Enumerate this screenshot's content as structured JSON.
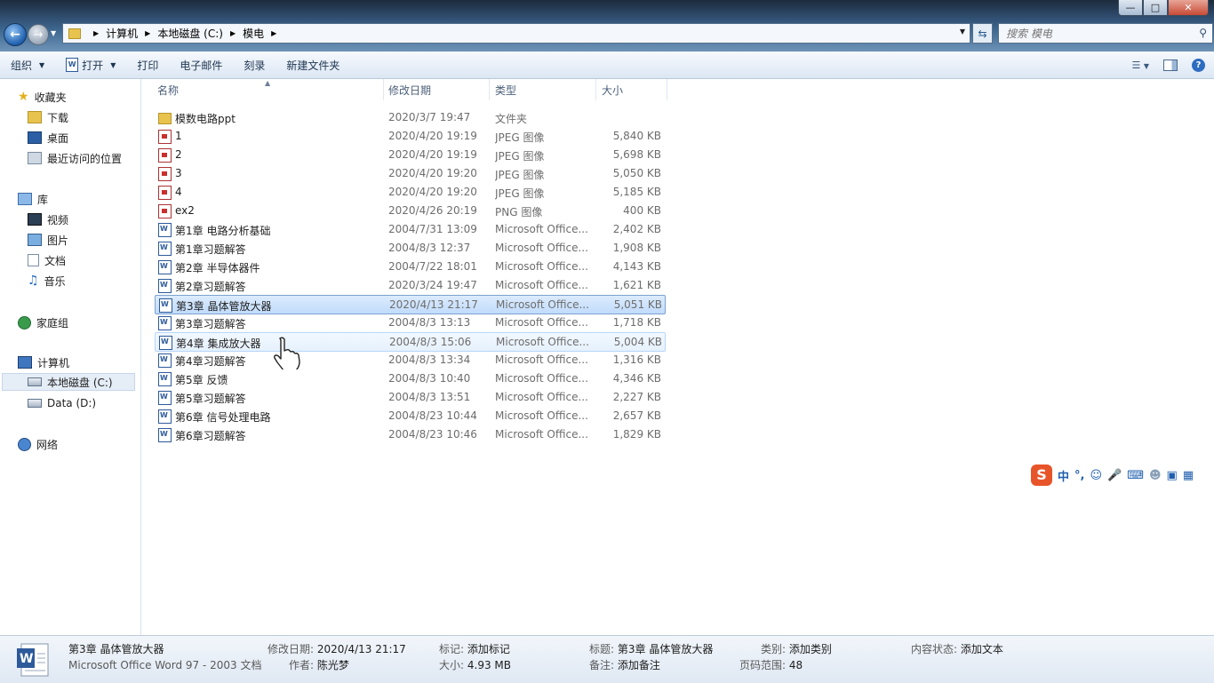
{
  "address": {
    "crumbs": [
      "计算机",
      "本地磁盘 (C:)",
      "模电"
    ],
    "search_placeholder": "搜索 模电"
  },
  "toolbar": {
    "organize": "组织",
    "open": "打开",
    "print": "打印",
    "email": "电子邮件",
    "burn": "刻录",
    "new_folder": "新建文件夹"
  },
  "nav": {
    "favorites": "收藏夹",
    "downloads": "下载",
    "desktop": "桌面",
    "recent": "最近访问的位置",
    "libraries": "库",
    "videos": "视频",
    "pictures": "图片",
    "documents": "文档",
    "music": "音乐",
    "homegroup": "家庭组",
    "computer": "计算机",
    "drive_c": "本地磁盘 (C:)",
    "drive_d": "Data (D:)",
    "network": "网络"
  },
  "columns": {
    "name": "名称",
    "date": "修改日期",
    "type": "类型",
    "size": "大小"
  },
  "files": [
    {
      "name": "模数电路ppt",
      "date": "2020/3/7 19:47",
      "type": "文件夹",
      "size": "",
      "icon": "folder"
    },
    {
      "name": "1",
      "date": "2020/4/20 19:19",
      "type": "JPEG 图像",
      "size": "5,840 KB",
      "icon": "image"
    },
    {
      "name": "2",
      "date": "2020/4/20 19:19",
      "type": "JPEG 图像",
      "size": "5,698 KB",
      "icon": "image"
    },
    {
      "name": "3",
      "date": "2020/4/20 19:20",
      "type": "JPEG 图像",
      "size": "5,050 KB",
      "icon": "image"
    },
    {
      "name": "4",
      "date": "2020/4/20 19:20",
      "type": "JPEG 图像",
      "size": "5,185 KB",
      "icon": "image"
    },
    {
      "name": "ex2",
      "date": "2020/4/26 20:19",
      "type": "PNG 图像",
      "size": "400 KB",
      "icon": "image"
    },
    {
      "name": "第1章 电路分析基础",
      "date": "2004/7/31 13:09",
      "type": "Microsoft Office...",
      "size": "2,402 KB",
      "icon": "word"
    },
    {
      "name": "第1章习题解答",
      "date": "2004/8/3 12:37",
      "type": "Microsoft Office...",
      "size": "1,908 KB",
      "icon": "word"
    },
    {
      "name": "第2章 半导体器件",
      "date": "2004/7/22 18:01",
      "type": "Microsoft Office...",
      "size": "4,143 KB",
      "icon": "word"
    },
    {
      "name": "第2章习题解答",
      "date": "2020/3/24 19:47",
      "type": "Microsoft Office...",
      "size": "1,621 KB",
      "icon": "word"
    },
    {
      "name": "第3章 晶体管放大器",
      "date": "2020/4/13 21:17",
      "type": "Microsoft Office...",
      "size": "5,051 KB",
      "icon": "word"
    },
    {
      "name": "第3章习题解答",
      "date": "2004/8/3 13:13",
      "type": "Microsoft Office...",
      "size": "1,718 KB",
      "icon": "word"
    },
    {
      "name": "第4章 集成放大器",
      "date": "2004/8/3 15:06",
      "type": "Microsoft Office...",
      "size": "5,004 KB",
      "icon": "word"
    },
    {
      "name": "第4章习题解答",
      "date": "2004/8/3 13:34",
      "type": "Microsoft Office...",
      "size": "1,316 KB",
      "icon": "word"
    },
    {
      "name": "第5章 反馈",
      "date": "2004/8/3 10:40",
      "type": "Microsoft Office...",
      "size": "4,346 KB",
      "icon": "word"
    },
    {
      "name": "第5章习题解答",
      "date": "2004/8/3 13:51",
      "type": "Microsoft Office...",
      "size": "2,227 KB",
      "icon": "word"
    },
    {
      "name": "第6章 信号处理电路",
      "date": "2004/8/23 10:44",
      "type": "Microsoft Office...",
      "size": "2,657 KB",
      "icon": "word"
    },
    {
      "name": "第6章习题解答",
      "date": "2004/8/23 10:46",
      "type": "Microsoft Office...",
      "size": "1,829 KB",
      "icon": "word"
    }
  ],
  "selected_index": 10,
  "hover_index": 12,
  "ime": {
    "logo": "S",
    "mode": "中",
    "punct": "°,"
  },
  "details": {
    "name": "第3章 晶体管放大器",
    "kind": "Microsoft Office Word 97 - 2003 文档",
    "modified_label": "修改日期:",
    "modified_value": "2020/4/13 21:17",
    "author_label": "作者:",
    "author_value": "陈光梦",
    "tags_label": "标记:",
    "tags_value": "添加标记",
    "size_label": "大小:",
    "size_value": "4.93 MB",
    "title_label": "标题:",
    "title_value": "第3章 晶体管放大器",
    "comments_label": "备注:",
    "comments_value": "添加备注",
    "category_label": "类别:",
    "category_value": "添加类别",
    "pages_label": "页码范围:",
    "pages_value": "48",
    "status_label": "内容状态:",
    "status_value": "添加文本"
  }
}
